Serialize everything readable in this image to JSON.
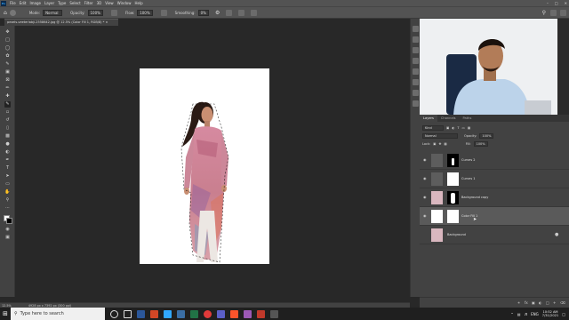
{
  "menubar": {
    "items": [
      "File",
      "Edit",
      "Image",
      "Layer",
      "Type",
      "Select",
      "Filter",
      "3D",
      "View",
      "Window",
      "Help"
    ]
  },
  "options": {
    "mode_label": "Mode:",
    "mode_value": "Normal",
    "opacity_label": "Opacity:",
    "opacity_value": "100%",
    "flow_label": "Flow:",
    "flow_value": "100%",
    "smoothing_label": "Smoothing:",
    "smoothing_value": "0%"
  },
  "document": {
    "tab_title": "pexels-veeterlabji-2558642.jpg @ 12.5% (Color Fill 1, RGB/8) *"
  },
  "status": {
    "zoom": "12.5%",
    "info": "4928 px x 7392 px (300 ppi)"
  },
  "panel": {
    "tabs": [
      "Layers",
      "Channels",
      "Paths"
    ],
    "kind": "Kind",
    "blend": "Normal",
    "opacity_label": "Opacity:",
    "opacity_value": "100%",
    "lock_label": "Lock:",
    "fill_label": "Fill:",
    "fill_value": "100%",
    "layers": [
      {
        "name": "Curves 2"
      },
      {
        "name": "Curves 1"
      },
      {
        "name": "Background copy"
      },
      {
        "name": "Color Fill 1"
      },
      {
        "name": "Background"
      }
    ]
  },
  "taskbar": {
    "search_placeholder": "Type here to search",
    "lang": "ENG",
    "time": "10:52 AM",
    "date": "7/31/2021"
  },
  "colors": {
    "accent": "#31a8ff",
    "panel": "#424242",
    "canvas": "#282828"
  }
}
